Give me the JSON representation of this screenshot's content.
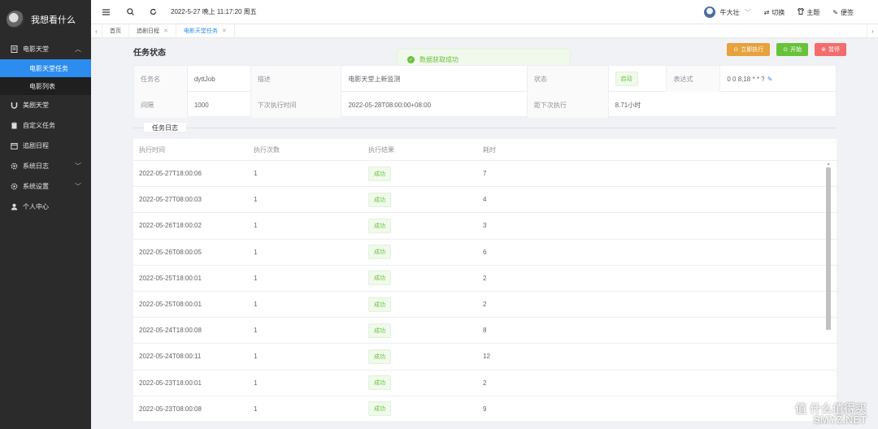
{
  "brand": {
    "title": "我想看什么"
  },
  "sidebar": {
    "items": [
      {
        "label": "电影天堂",
        "icon": "document-icon",
        "chevron": "︿"
      },
      {
        "label": "电影天堂任务",
        "sub": true,
        "active": true
      },
      {
        "label": "电影列表",
        "sub": true
      },
      {
        "label": "美剧天堂",
        "icon": "magnet-icon"
      },
      {
        "label": "自定义任务",
        "icon": "clipboard-icon"
      },
      {
        "label": "追剧日程",
        "icon": "calendar-icon"
      },
      {
        "label": "系统日志",
        "icon": "gear-icon",
        "chevron": "﹀"
      },
      {
        "label": "系统设置",
        "icon": "gear-icon",
        "chevron": "﹀"
      },
      {
        "label": "个人中心",
        "icon": "user-icon"
      }
    ]
  },
  "header": {
    "datetime": "2022-5-27 晚上 11:17:20 周五",
    "username": "牛大壮",
    "switch_label": "切换",
    "theme_label": "主题",
    "note_label": "便签"
  },
  "tabs": [
    {
      "label": "首页",
      "closable": false
    },
    {
      "label": "追剧日程",
      "closable": true
    },
    {
      "label": "电影天堂任务",
      "closable": true,
      "active": true
    }
  ],
  "main": {
    "section_title": "任务状态",
    "toast": "数据获取成功",
    "actions": {
      "run_now": "立即执行",
      "start": "开始",
      "pause": "暂停"
    },
    "desc": {
      "name_label": "任务名",
      "name_value": "dyttJob",
      "desc_label": "描述",
      "desc_value": "电影天堂上新监测",
      "status_label": "状态",
      "status_value": "启动",
      "expr_label": "表达式",
      "expr_value": "0 0 8,18 * * ?",
      "interval_label": "间隔",
      "interval_value": "1000",
      "next_label": "下次执行时间",
      "next_value": "2022-05-28T08:00:00+08:00",
      "dist_label": "距下次执行",
      "dist_value": "8.71小时"
    },
    "log_title": "任务日志",
    "table": {
      "headers": [
        "执行时间",
        "执行次数",
        "执行结果",
        "耗时"
      ],
      "rows": [
        {
          "time": "2022-05-27T18:00:06",
          "count": "1",
          "result": "成功",
          "cost": "7"
        },
        {
          "time": "2022-05-27T08:00:03",
          "count": "1",
          "result": "成功",
          "cost": "4"
        },
        {
          "time": "2022-05-26T18:00:02",
          "count": "1",
          "result": "成功",
          "cost": "3"
        },
        {
          "time": "2022-05-26T08:00:05",
          "count": "1",
          "result": "成功",
          "cost": "6"
        },
        {
          "time": "2022-05-25T18:00:01",
          "count": "1",
          "result": "成功",
          "cost": "2"
        },
        {
          "time": "2022-05-25T08:00:01",
          "count": "1",
          "result": "成功",
          "cost": "2"
        },
        {
          "time": "2022-05-24T18:00:08",
          "count": "1",
          "result": "成功",
          "cost": "8"
        },
        {
          "time": "2022-05-24T08:00:11",
          "count": "1",
          "result": "成功",
          "cost": "12"
        },
        {
          "time": "2022-05-23T18:00:01",
          "count": "1",
          "result": "成功",
          "cost": "2"
        },
        {
          "time": "2022-05-23T08:00:08",
          "count": "1",
          "result": "成功",
          "cost": "9"
        }
      ]
    }
  },
  "watermark": {
    "line1": "值 什么值得买",
    "line2": "SMYZ.NET"
  },
  "colors": {
    "accent": "#2d8cf0",
    "success": "#67c23a",
    "warning": "#e6a23c",
    "danger": "#f56c6c",
    "sidebar": "#2b2b2b"
  }
}
